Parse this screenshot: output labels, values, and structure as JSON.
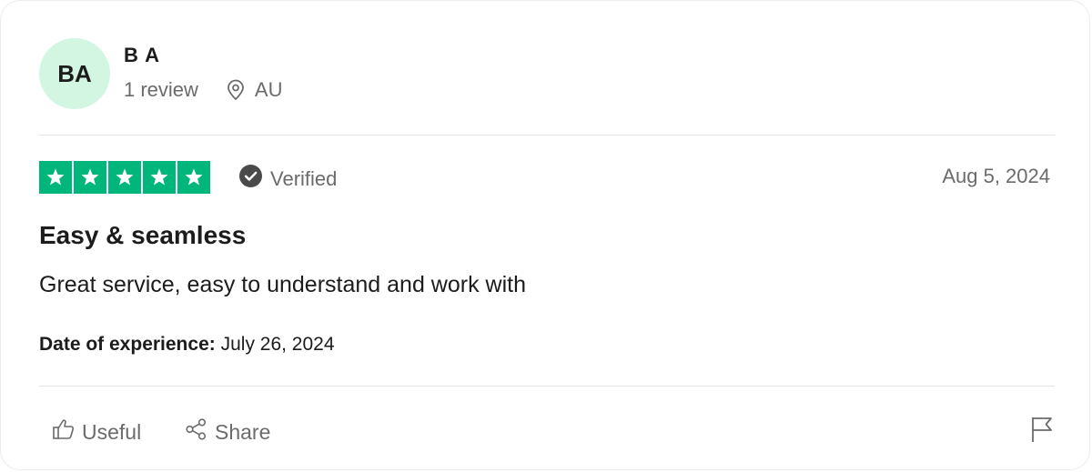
{
  "reviewer": {
    "initials": "BA",
    "name": "B A",
    "review_count": "1 review",
    "country": "AU"
  },
  "review": {
    "rating": 5,
    "rating_max": 5,
    "verified_label": "Verified",
    "date": "Aug 5, 2024",
    "title": "Easy & seamless",
    "body": "Great service, easy to understand and work with",
    "experience_label": "Date of experience:",
    "experience_date": "July 26, 2024"
  },
  "actions": {
    "useful_label": "Useful",
    "share_label": "Share"
  },
  "colors": {
    "star_green": "#00b67a",
    "avatar_bg": "#d3f6e3"
  },
  "icons": {
    "location": "location-pin-icon",
    "verified": "check-circle-icon",
    "useful": "thumbs-up-icon",
    "share": "share-icon",
    "report": "flag-icon"
  }
}
